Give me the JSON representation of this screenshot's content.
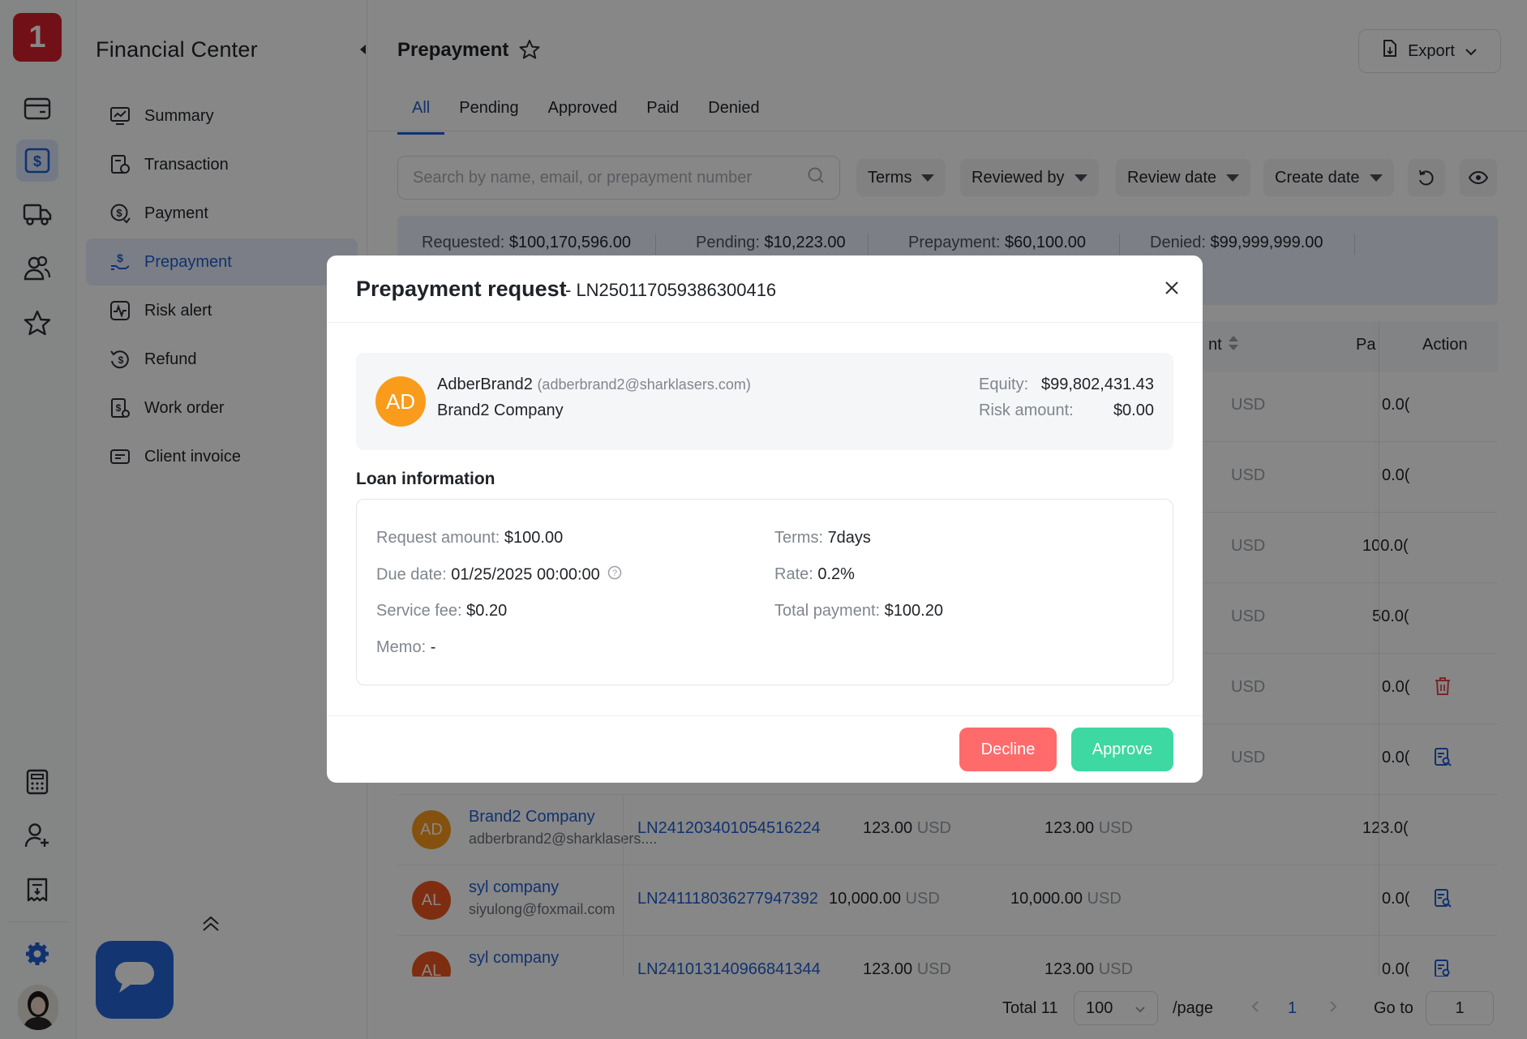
{
  "rail": {
    "logo": "1",
    "icons": [
      "wallet-icon",
      "dollar-icon",
      "truck-icon",
      "users-icon",
      "star-icon",
      "calculator-icon",
      "add-user-icon",
      "invoice-icon",
      "settings-icon"
    ]
  },
  "nav": {
    "title": "Financial Center",
    "items": [
      {
        "label": "Summary",
        "icon": "chart-icon"
      },
      {
        "label": "Transaction",
        "icon": "transaction-icon"
      },
      {
        "label": "Payment",
        "icon": "payment-icon"
      },
      {
        "label": "Prepayment",
        "icon": "prepayment-icon"
      },
      {
        "label": "Risk alert",
        "icon": "risk-icon"
      },
      {
        "label": "Refund",
        "icon": "refund-icon"
      },
      {
        "label": "Work order",
        "icon": "work-order-icon"
      },
      {
        "label": "Client invoice",
        "icon": "client-invoice-icon"
      }
    ],
    "active_index": 3
  },
  "page": {
    "title": "Prepayment",
    "export_label": "Export",
    "tabs": [
      "All",
      "Pending",
      "Approved",
      "Paid",
      "Denied"
    ],
    "active_tab": 0,
    "search_placeholder": "Search by name, email, or prepayment number",
    "filters": [
      "Terms",
      "Reviewed by",
      "Review date",
      "Create date"
    ]
  },
  "summary": [
    {
      "label": "Requested:",
      "value": "$100,170,596.00"
    },
    {
      "label": "Pending:",
      "value": "$10,223.00"
    },
    {
      "label": "Prepayment:",
      "value": "$60,100.00"
    },
    {
      "label": "Denied:",
      "value": "$99,999,999.00"
    }
  ],
  "table": {
    "headers": {
      "amount_partial": "nt",
      "paid_partial": "Pa",
      "action": "Action"
    },
    "currency": "USD",
    "rows": [
      {
        "col4": "",
        "col5": "0.0("
      },
      {
        "col4": "",
        "col5": "0.0("
      },
      {
        "col4": "",
        "col5": "100.0("
      },
      {
        "col4": "",
        "col5": "50.0("
      },
      {
        "col4": "",
        "col5": "0.0(",
        "action": "delete-icon"
      },
      {
        "col4": "",
        "col5": "0.0(",
        "action": "review-icon"
      },
      {
        "initials": "AD",
        "name": "Brand2 Company",
        "email": "adberbrand2@sharklasers....",
        "number": "LN241203401054516224",
        "amount": "123.00",
        "payment": "123.00",
        "paid": "123.0(",
        "color": "#fa9c1b"
      },
      {
        "initials": "AL",
        "name": "syl company",
        "email": "siyulong@foxmail.com",
        "number": "LN241118036277947392",
        "amount": "10,000.00",
        "payment": "10,000.00",
        "paid": "0.0(",
        "action": "review-icon",
        "color": "#f0561f"
      },
      {
        "initials": "AL",
        "name": "syl company",
        "email": "",
        "number": "LN241013140966841344",
        "amount": "123.00",
        "payment": "123.00",
        "paid": "0.0(",
        "action": "review-icon",
        "color": "#f0561f"
      }
    ]
  },
  "pager": {
    "total": "Total 11",
    "page_size": "100",
    "per_page": "/page",
    "current": "1",
    "goto_label": "Go to",
    "goto_value": "1"
  },
  "modal": {
    "title": "Prepayment request",
    "number": "- LN250117059386300416",
    "client": {
      "initials": "AD",
      "name": "AdberBrand2",
      "email": "(adberbrand2@sharklasers.com)",
      "company": "Brand2 Company",
      "equity_label": "Equity:",
      "equity": "$99,802,431.43",
      "risk_label": "Risk amount:",
      "risk": "$0.00"
    },
    "loan_heading": "Loan information",
    "loan": {
      "request_amount_label": "Request amount:",
      "request_amount": "$100.00",
      "terms_label": "Terms:",
      "terms": "7days",
      "due_date_label": "Due date:",
      "due_date": "01/25/2025 00:00:00",
      "rate_label": "Rate:",
      "rate": "0.2%",
      "service_fee_label": "Service fee:",
      "service_fee": "$0.20",
      "total_payment_label": "Total payment:",
      "total_payment": "$100.20",
      "memo_label": "Memo:",
      "memo": "-"
    },
    "decline_label": "Decline",
    "approve_label": "Approve"
  },
  "colors": {
    "accent": "#1f5fd1",
    "decline": "#ff6b6b",
    "approve": "#3ed8a2",
    "logo": "#d6202c"
  }
}
